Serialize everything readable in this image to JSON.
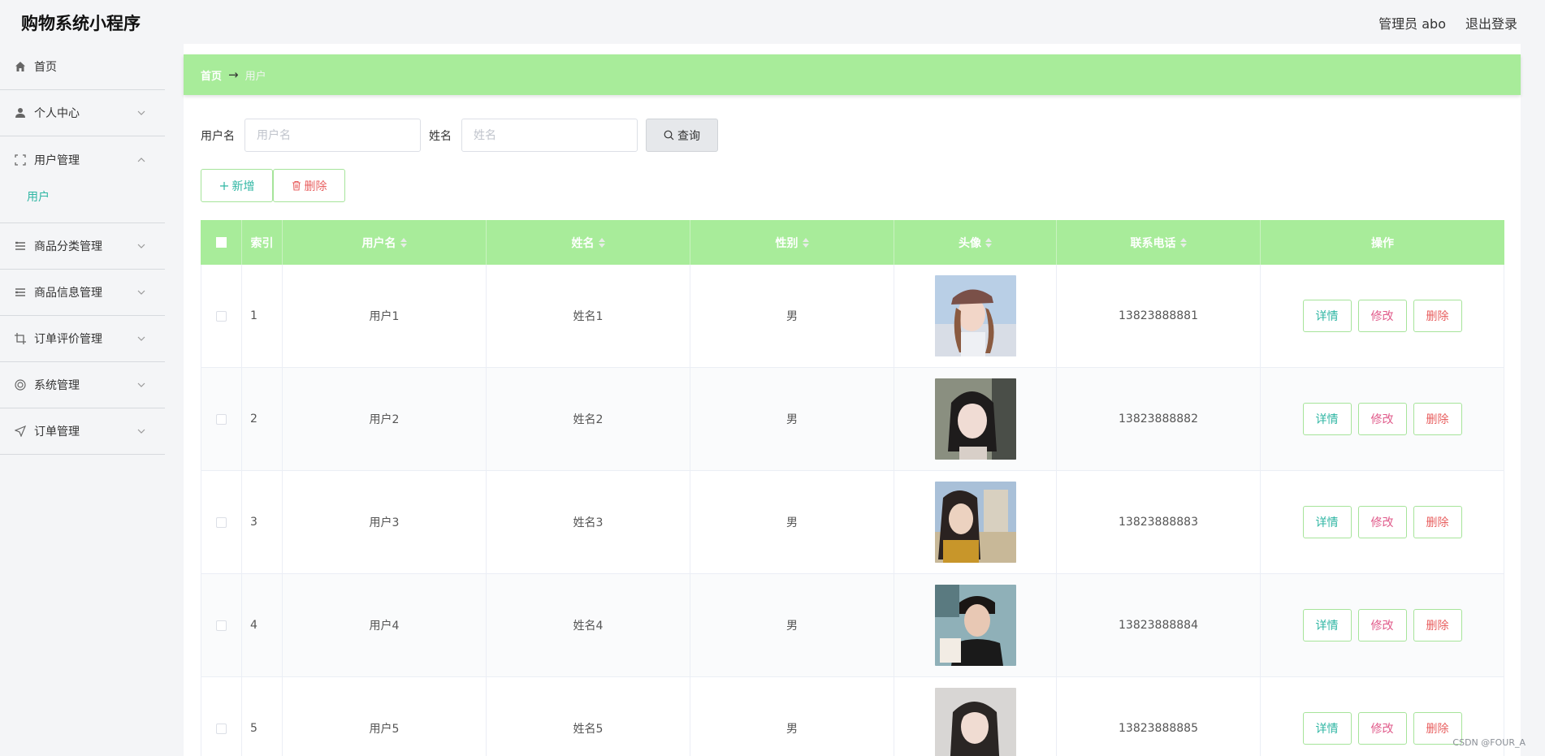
{
  "app": {
    "title": "购物系统小程序"
  },
  "header": {
    "user_label": "管理员 abo",
    "logout_label": "退出登录"
  },
  "sidebar": {
    "items": [
      {
        "label": "首页",
        "icon": "home-icon"
      },
      {
        "label": "个人中心",
        "icon": "user-icon"
      },
      {
        "label": "用户管理",
        "icon": "fullscreen-icon",
        "open": true,
        "children": [
          "用户"
        ]
      },
      {
        "label": "商品分类管理",
        "icon": "list-icon"
      },
      {
        "label": "商品信息管理",
        "icon": "list-icon"
      },
      {
        "label": "订单评价管理",
        "icon": "crop-icon"
      },
      {
        "label": "系统管理",
        "icon": "lifebuoy-icon"
      },
      {
        "label": "订单管理",
        "icon": "send-icon"
      }
    ]
  },
  "breadcrumb": {
    "home": "首页",
    "separator": "→",
    "current": "用户"
  },
  "search": {
    "username_label": "用户名",
    "username_placeholder": "用户名",
    "name_label": "姓名",
    "name_placeholder": "姓名",
    "query_label": "查询"
  },
  "actions": {
    "add_label": "新增",
    "delete_label": "删除"
  },
  "table": {
    "headers": [
      "索引",
      "用户名",
      "姓名",
      "性别",
      "头像",
      "联系电话",
      "操作"
    ],
    "rows": [
      {
        "index": "1",
        "username": "用户1",
        "name": "姓名1",
        "gender": "男",
        "phone": "13823888881"
      },
      {
        "index": "2",
        "username": "用户2",
        "name": "姓名2",
        "gender": "男",
        "phone": "13823888882"
      },
      {
        "index": "3",
        "username": "用户3",
        "name": "姓名3",
        "gender": "男",
        "phone": "13823888883"
      },
      {
        "index": "4",
        "username": "用户4",
        "name": "姓名4",
        "gender": "男",
        "phone": "13823888884"
      },
      {
        "index": "5",
        "username": "用户5",
        "name": "姓名5",
        "gender": "男",
        "phone": "13823888885"
      }
    ],
    "row_actions": {
      "detail": "详情",
      "edit": "修改",
      "delete": "删除"
    }
  },
  "colors": {
    "accent_green": "#a8ec9a",
    "teal": "#2fb6a3",
    "pink": "#e05a8a",
    "red": "#e86060"
  },
  "watermark": "CSDN @FOUR_A"
}
